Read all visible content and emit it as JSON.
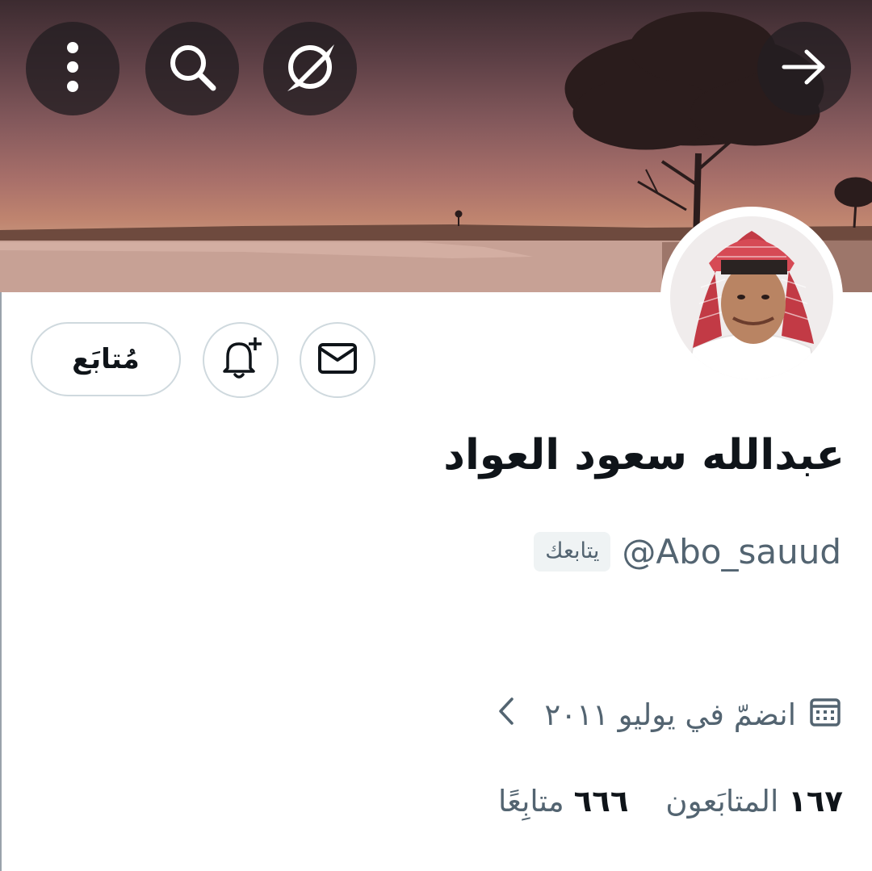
{
  "header": {
    "back_icon": "arrow-right-icon",
    "toolbar_icons": [
      "more-vertical-icon",
      "search-icon",
      "no-sign-icon"
    ]
  },
  "actions": {
    "follow_label": "مُتابَع",
    "notify_icon": "bell-plus-icon",
    "message_icon": "envelope-icon"
  },
  "profile": {
    "display_name": "عبدالله سعود العواد",
    "handle": "@Abo_sauud",
    "follows_you_badge": "يتابعك",
    "joined_text": "انضمّ في يوليو ٢٠١١",
    "joined_icon": "calendar-icon",
    "following_count": "٦٦٦",
    "following_label": "متابِعًا",
    "followers_count": "١٦٧",
    "followers_label": "المتابَعون"
  },
  "colors": {
    "text_primary": "#0f1419",
    "text_secondary": "#536471",
    "border": "#cfd9de",
    "badge_bg": "#eff3f4"
  }
}
